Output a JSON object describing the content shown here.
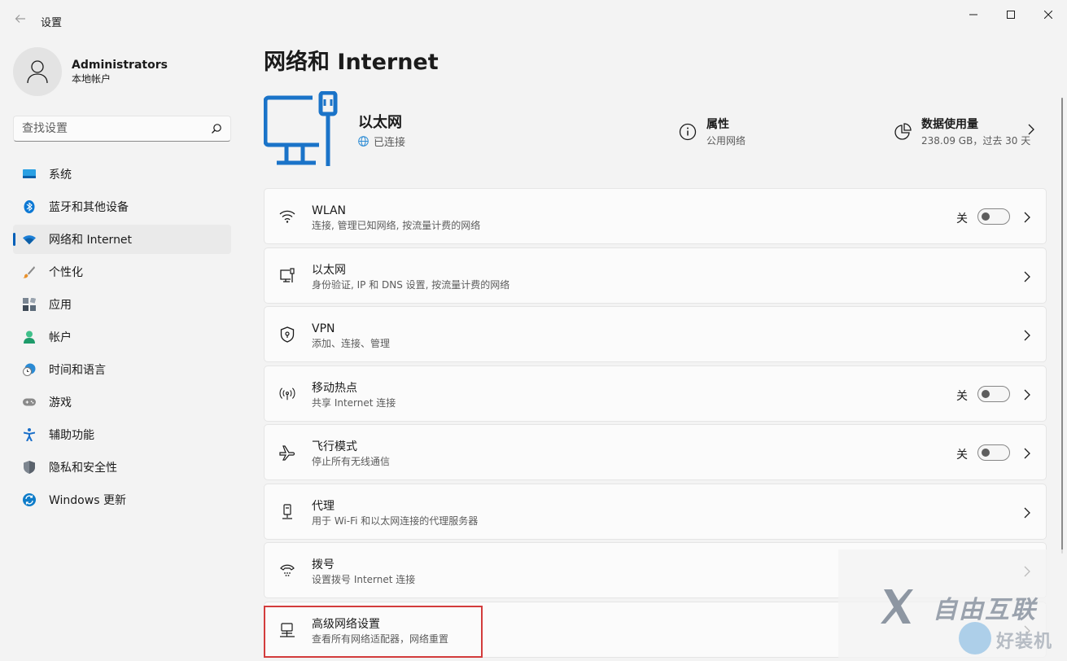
{
  "window": {
    "title": "设置",
    "back_icon": "back-arrow-icon",
    "controls": [
      "minimize-icon",
      "maximize-icon",
      "close-icon"
    ]
  },
  "profile": {
    "name": "Administrators",
    "account_type": "本地帐户"
  },
  "search": {
    "placeholder": "查找设置"
  },
  "sidebar": {
    "items": [
      {
        "label": "系统",
        "icon": "system-icon",
        "color": "#0078d4"
      },
      {
        "label": "蓝牙和其他设备",
        "icon": "bluetooth-icon",
        "color": "#0078d4"
      },
      {
        "label": "网络和 Internet",
        "icon": "wifi-icon",
        "color": "#0078d4",
        "active": true
      },
      {
        "label": "个性化",
        "icon": "brush-icon",
        "color": "#e8912d"
      },
      {
        "label": "应用",
        "icon": "apps-icon",
        "color": "#5c6b7a"
      },
      {
        "label": "帐户",
        "icon": "account-icon",
        "color": "#2fb37a"
      },
      {
        "label": "时间和语言",
        "icon": "clock-globe-icon",
        "color": "#2a8ad4"
      },
      {
        "label": "游戏",
        "icon": "gamepad-icon",
        "color": "#7a7a7a"
      },
      {
        "label": "辅助功能",
        "icon": "accessibility-icon",
        "color": "#1a6fc9"
      },
      {
        "label": "隐私和安全性",
        "icon": "shield-icon",
        "color": "#6d7580"
      },
      {
        "label": "Windows 更新",
        "icon": "update-icon",
        "color": "#0e7cc9"
      }
    ]
  },
  "main": {
    "title": "网络和 Internet",
    "hero": {
      "name": "以太网",
      "status": "已连接",
      "properties_label": "属性",
      "properties_sub": "公用网络",
      "usage_label": "数据使用量",
      "usage_sub": "238.09 GB，过去 30 天"
    },
    "cards": [
      {
        "title": "WLAN",
        "subtitle": "连接, 管理已知网络, 按流量计费的网络",
        "icon": "wifi-icon",
        "toggle": "关"
      },
      {
        "title": "以太网",
        "subtitle": "身份验证, IP 和 DNS 设置, 按流量计费的网络",
        "icon": "ethernet-icon"
      },
      {
        "title": "VPN",
        "subtitle": "添加、连接、管理",
        "icon": "vpn-shield-icon"
      },
      {
        "title": "移动热点",
        "subtitle": "共享 Internet 连接",
        "icon": "hotspot-icon",
        "toggle": "关"
      },
      {
        "title": "飞行模式",
        "subtitle": "停止所有无线通信",
        "icon": "airplane-icon",
        "toggle": "关"
      },
      {
        "title": "代理",
        "subtitle": "用于 Wi-Fi 和以太网连接的代理服务器",
        "icon": "proxy-icon"
      },
      {
        "title": "拨号",
        "subtitle": "设置拨号 Internet 连接",
        "icon": "dialup-icon"
      },
      {
        "title": "高级网络设置",
        "subtitle": "查看所有网络适配器，网络重置",
        "icon": "advanced-network-icon"
      }
    ]
  },
  "watermark": {
    "text": "自由互联",
    "text2": "好装机"
  },
  "colors": {
    "accent": "#005fb8",
    "highlight": "#d23f3f"
  }
}
